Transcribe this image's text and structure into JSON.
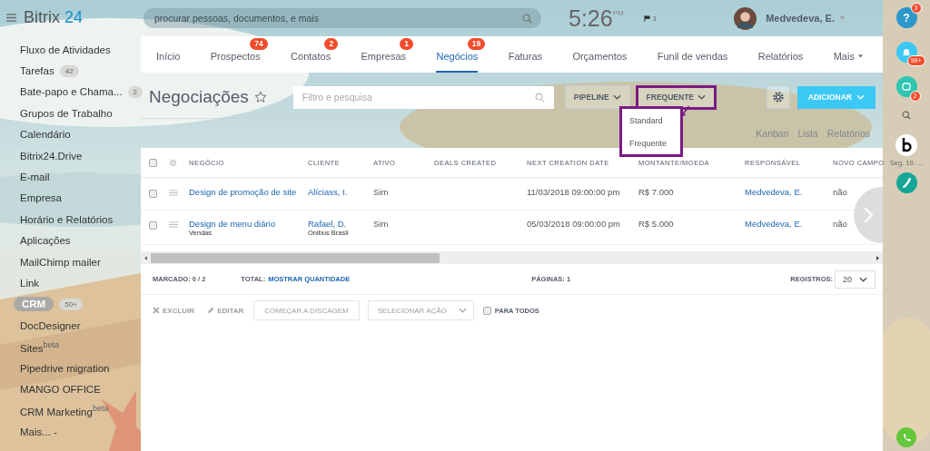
{
  "logo": {
    "name": "Bitrix",
    "number": "24"
  },
  "sidebar": {
    "items": [
      {
        "label": "Fluxo de Atividades",
        "selected": false
      },
      {
        "label": "Tarefas",
        "counter": "42",
        "selected": false
      },
      {
        "label": "Bate-papo e Chama...",
        "counter": "2",
        "selected": false
      },
      {
        "label": "Grupos de Trabalho",
        "selected": false
      },
      {
        "label": "Calendário",
        "selected": false
      },
      {
        "label": "Bitrix24.Drive",
        "selected": false
      },
      {
        "label": "E-mail",
        "selected": false
      },
      {
        "label": "Empresa",
        "selected": false
      },
      {
        "label": "Horário e Relatórios",
        "selected": false
      },
      {
        "label": "Aplicações",
        "selected": false
      },
      {
        "label": "MailChimp mailer",
        "selected": false
      },
      {
        "label": "Link",
        "selected": false
      },
      {
        "label": "CRM",
        "counter": "50+",
        "selected": true
      },
      {
        "label": "DocDesigner",
        "selected": false
      },
      {
        "label": "Sites$^{beta}$",
        "selected": false
      },
      {
        "label": "Pipedrive migration",
        "selected": false
      },
      {
        "label": "MANGO OFFICE",
        "selected": false
      },
      {
        "label": "CRM Marketing$^{beta}$",
        "selected": false
      },
      {
        "label": "Mais... -",
        "selected": false
      }
    ]
  },
  "header": {
    "search_placeholder": "procurar pessoas, documentos, e mais",
    "time": "5:26",
    "ampm": "PM",
    "flag_count": "1",
    "user": "Medvedeva, E."
  },
  "tabs": [
    {
      "label": "Início",
      "selected": false
    },
    {
      "label": "Prospectos",
      "badge": "74",
      "selected": false
    },
    {
      "label": "Contatos",
      "badge": "2",
      "selected": false
    },
    {
      "label": "Empresas",
      "badge": "1",
      "selected": false
    },
    {
      "label": "Negócios",
      "badge": "19",
      "selected": true
    },
    {
      "label": "Faturas",
      "selected": false
    },
    {
      "label": "Orçamentos",
      "selected": false
    },
    {
      "label": "Funil de vendas",
      "selected": false
    },
    {
      "label": "Relatórios",
      "selected": false
    },
    {
      "label": "Mais",
      "selected": false
    }
  ],
  "toolbar": {
    "title": "Negociações",
    "filter_placeholder": "Filtro e pesquisa",
    "pipeline": "PIPELINE",
    "category": "FREQUENTE",
    "add": "ADICIONAR"
  },
  "category_menu": {
    "items": [
      "Standard",
      "Frequente"
    ]
  },
  "views": [
    {
      "label": "Kanban",
      "selected": false
    },
    {
      "label": "Lista",
      "selected": true
    },
    {
      "label": "Relatórios",
      "selected": false
    }
  ],
  "table": {
    "all_checked": false,
    "columns": [
      "NEGÓCIO",
      "CLIENTE",
      "ATIVO",
      "DEALS CREATED",
      "NEXT CREATION DATE",
      "MONTANTE/MOEDA",
      "RESPONSÁVEL",
      "NOVO CAMPO"
    ],
    "rows": [
      {
        "checked": false,
        "deal": "Design de promoção de site",
        "client": "Alíciass, I.",
        "active": "Sim",
        "next_date": "11/03/2018 09:00:00 pm",
        "amount": "R$ 7.000",
        "responsible": "Medvedeva, E.",
        "novo_campo": "não"
      },
      {
        "checked": false,
        "deal": "Design de menu diário",
        "deal_sub": "Vendas",
        "client": "Rafael, D.",
        "client_sub": "Onibus Brasil",
        "active": "Sim",
        "next_date": "05/03/2018 09:00:00 pm",
        "amount": "R$ 5.000",
        "responsible": "Medvedeva, E.",
        "novo_campo": "não"
      }
    ]
  },
  "footer": {
    "marked_label": "MARCADO:",
    "marked": "0 / 2",
    "total_label": "TOTAL:",
    "total_link": "MOSTRAR QUANTIDADE",
    "pages_label": "PÁGINAS:",
    "pages": "1",
    "records_label": "REGISTROS:",
    "records": "20"
  },
  "actions": {
    "delete": "EXCLUIR",
    "edit": "EDITAR",
    "dial": "COMEÇAR A DISCAGEM",
    "select_action": "SELECIONAR AÇÃO",
    "for_all": "PARA TODOS",
    "for_all_checked": false
  },
  "right_bar": {
    "help_label": "?",
    "help_badge": "3",
    "notify_badge": "99+",
    "chat_badge": "2",
    "date": "Seg. 19. ..."
  }
}
